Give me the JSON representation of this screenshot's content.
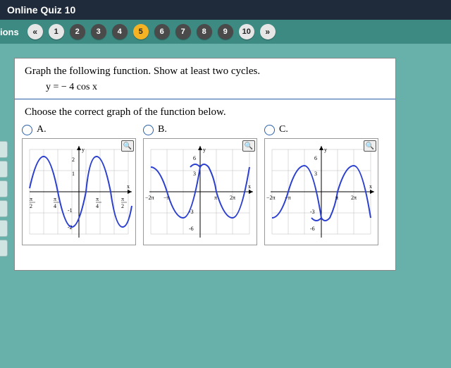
{
  "header": {
    "title": "Online Quiz 10"
  },
  "nav": {
    "label": "ions",
    "prev": "«",
    "next": "»",
    "items": [
      "1",
      "2",
      "3",
      "4",
      "5",
      "6",
      "7",
      "8",
      "9",
      "10"
    ],
    "current": 5
  },
  "question": {
    "prompt": "Graph the following function. Show at least two cycles.",
    "equation": "y = − 4 cos x",
    "choose": "Choose the correct graph of the function below."
  },
  "options": {
    "a": {
      "label": "A.",
      "ylabel": "y",
      "xlabel": "x",
      "xticks": [
        "−π/2",
        "−π/4",
        "π/4",
        "π/2"
      ],
      "yticks": [
        "2",
        "1",
        "-1",
        "-2"
      ]
    },
    "b": {
      "label": "B.",
      "ylabel": "y",
      "xlabel": "x",
      "xticks": [
        "−2π",
        "−π",
        "π",
        "2π"
      ],
      "yticks": [
        "6",
        "3",
        "-3",
        "-6"
      ]
    },
    "c": {
      "label": "C.",
      "ylabel": "y",
      "xlabel": "x",
      "xticks": [
        "−2π",
        "−π",
        "π",
        "2π"
      ],
      "yticks": [
        "6",
        "3",
        "-3",
        "-6"
      ]
    }
  },
  "zoom_icon": "🔍",
  "chart_data": [
    {
      "id": "A",
      "type": "line",
      "title": "",
      "xlabel": "x",
      "ylabel": "y",
      "xlim": [
        -1.7,
        1.7
      ],
      "ylim": [
        -2.5,
        2.5
      ],
      "function": "y = -4 cos x (compressed view)",
      "series": [
        {
          "name": "y",
          "points": "-cos wave amplitude ~2 over ~2 cycles in view"
        }
      ]
    },
    {
      "id": "B",
      "type": "line",
      "title": "",
      "xlabel": "x",
      "ylabel": "y",
      "xlim": [
        -7,
        7
      ],
      "ylim": [
        -7,
        7
      ],
      "function": "y = 4 cos x",
      "series": [
        {
          "name": "y",
          "sample": [
            [
              -6.28,
              4
            ],
            [
              -3.14,
              -4
            ],
            [
              0,
              4
            ],
            [
              3.14,
              -4
            ],
            [
              6.28,
              4
            ]
          ]
        }
      ]
    },
    {
      "id": "C",
      "type": "line",
      "title": "",
      "xlabel": "x",
      "ylabel": "y",
      "xlim": [
        -7,
        7
      ],
      "ylim": [
        -7,
        7
      ],
      "function": "y = -4 cos x",
      "series": [
        {
          "name": "y",
          "sample": [
            [
              -6.28,
              -4
            ],
            [
              -3.14,
              4
            ],
            [
              0,
              -4
            ],
            [
              3.14,
              4
            ],
            [
              6.28,
              -4
            ]
          ]
        }
      ]
    }
  ]
}
